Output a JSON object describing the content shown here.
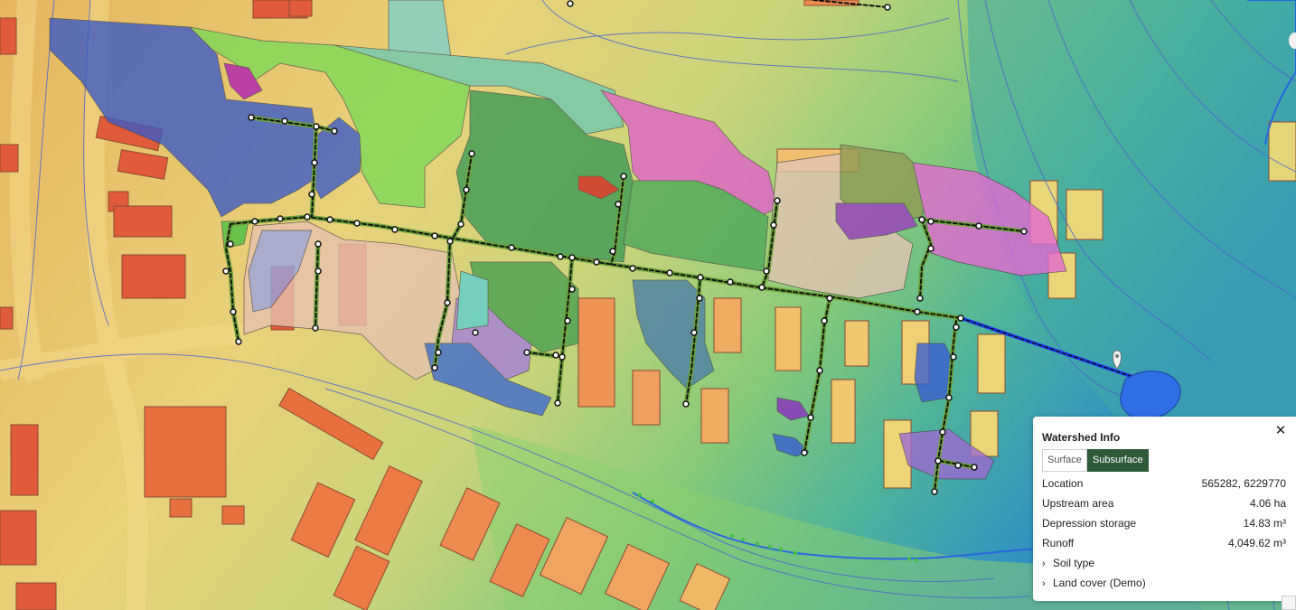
{
  "map": {
    "colors": {
      "network_fill": "#6ba23a",
      "network_dash": "#111111",
      "node_fill": "#ffffff",
      "outlet_pipe": "#1a3cff",
      "building_low": "#e0553a",
      "building_high": "#f0d878",
      "water": "#2f6fe8",
      "contour": "#4060d0"
    },
    "marker_icon": "location-pin-icon"
  },
  "panel": {
    "title": "Watershed Info",
    "close": "✕",
    "tabs": [
      "Surface",
      "Subsurface"
    ],
    "active_tab": "Subsurface",
    "rows": [
      {
        "label": "Location",
        "value": "565282, 6229770"
      },
      {
        "label": "Upstream area",
        "value": "4.06 ha"
      },
      {
        "label": "Depression storage",
        "value": "14.83 m³"
      },
      {
        "label": "Runoff",
        "value": "4,049.62 m³"
      }
    ],
    "sections": [
      "Soil type",
      "Land cover (Demo)"
    ]
  }
}
